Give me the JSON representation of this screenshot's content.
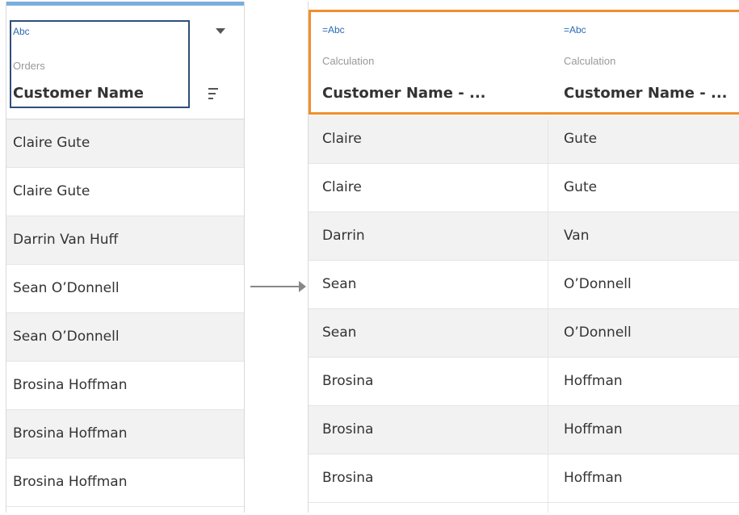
{
  "source": {
    "type_label": "Abc",
    "table": "Orders",
    "field": "Customer Name",
    "rows": [
      "Claire Gute",
      "Claire Gute",
      "Darrin Van Huff",
      "Sean O’Donnell",
      "Sean O’Donnell",
      "Brosina Hoffman",
      "Brosina Hoffman",
      "Brosina Hoffman"
    ]
  },
  "result": {
    "columns": [
      {
        "type_label": "=Abc",
        "source": "Calculation",
        "field": "Customer Name - ..."
      },
      {
        "type_label": "=Abc",
        "source": "Calculation",
        "field": "Customer Name - ..."
      }
    ],
    "rows": [
      [
        "Claire",
        "Gute"
      ],
      [
        "Claire",
        "Gute"
      ],
      [
        "Darrin",
        "Van"
      ],
      [
        "Sean",
        "O’Donnell"
      ],
      [
        "Sean",
        "O’Donnell"
      ],
      [
        "Brosina",
        "Hoffman"
      ],
      [
        "Brosina",
        "Hoffman"
      ],
      [
        "Brosina",
        "Hoffman"
      ]
    ]
  },
  "icons": {
    "dropdown": "chevron-down-icon",
    "sort": "sort-icon",
    "arrow": "arrow-right-icon"
  },
  "colors": {
    "selection_blue": "#2f4f78",
    "highlight_orange": "#f28e2b",
    "top_bar": "#7aaede"
  }
}
